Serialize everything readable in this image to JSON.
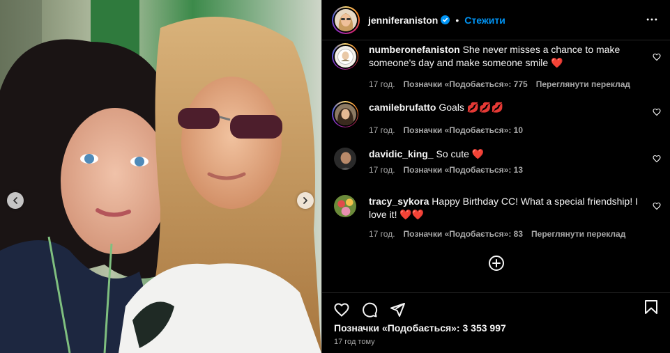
{
  "post": {
    "username": "jenniferaniston",
    "follow_label": "Стежити",
    "separator": "•",
    "likes_text": "Позначки «Подобається»: 3 353 997",
    "time_ago": "17 год тому"
  },
  "comments": [
    {
      "user": "numberonefaniston",
      "text": "She never misses a chance to make someone's day and make someone smile",
      "emoji": "❤️",
      "age": "17 год.",
      "likes": "Позначки «Подобається»: 775",
      "translate": "Переглянути переклад"
    },
    {
      "user": "camilebrufatto",
      "text": "Goals",
      "emoji": "💋💋💋",
      "age": "17 год.",
      "likes": "Позначки «Подобається»: 10",
      "translate": ""
    },
    {
      "user": "davidic_king_",
      "text": "So cute",
      "emoji": "❤️",
      "age": "17 год.",
      "likes": "Позначки «Подобається»: 13",
      "translate": ""
    },
    {
      "user": "tracy_sykora",
      "text": "Happy Birthday CC! What a special friendship! I love it!",
      "emoji": "❤️❤️",
      "age": "17 год.",
      "likes": "Позначки «Подобається»: 83",
      "translate": "Переглянути переклад"
    }
  ],
  "icons": {
    "more": "more-horizontal-icon",
    "verified": "verified-badge-icon",
    "heart": "heart-icon",
    "comment": "comment-icon",
    "share": "paper-plane-icon",
    "bookmark": "bookmark-icon",
    "add": "plus-circle-icon"
  },
  "colors": {
    "background": "#000000",
    "link": "#0095f6",
    "meta": "#a8a8a8",
    "heart": "#ed4956"
  }
}
